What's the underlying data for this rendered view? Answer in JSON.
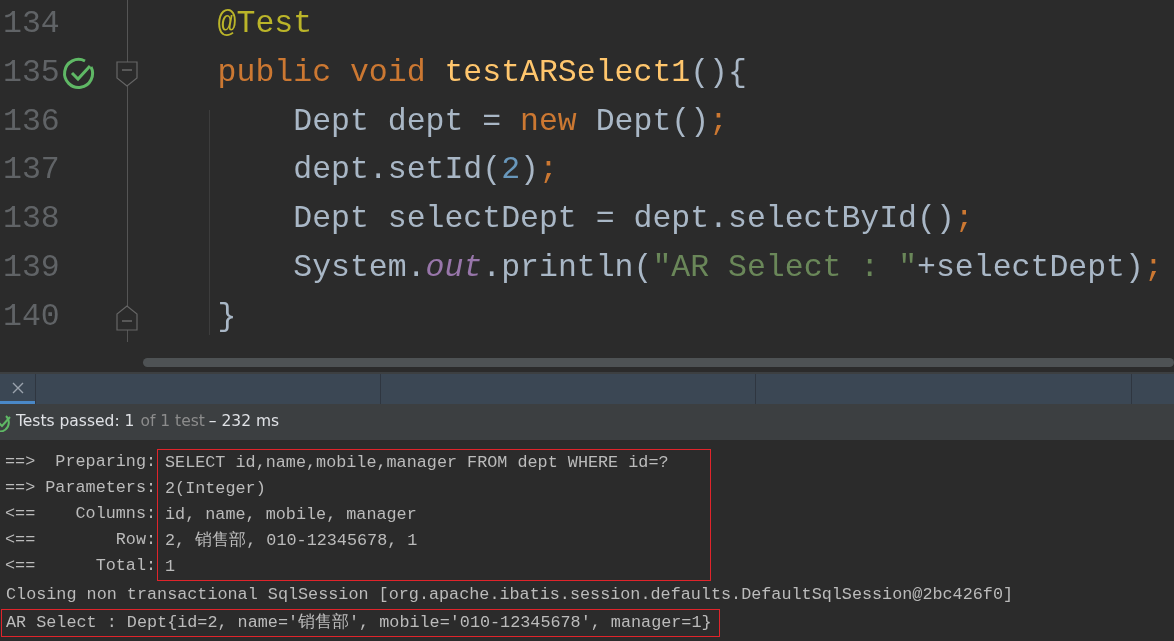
{
  "editor": {
    "lines": [
      {
        "number": "134",
        "tokens": [
          {
            "kind": "annotation",
            "text": "    @Test"
          }
        ]
      },
      {
        "number": "135",
        "test_passed": true,
        "fold_start": true,
        "tokens": [
          {
            "kind": "keyword",
            "text": "    public void "
          },
          {
            "kind": "method",
            "text": "testARSelect1"
          },
          {
            "kind": "plain",
            "text": "(){"
          }
        ]
      },
      {
        "number": "136",
        "tokens": [
          {
            "kind": "plain",
            "text": "        Dept dept = "
          },
          {
            "kind": "keyword",
            "text": "new "
          },
          {
            "kind": "plain",
            "text": "Dept()"
          },
          {
            "kind": "keyword",
            "text": ";"
          }
        ]
      },
      {
        "number": "137",
        "tokens": [
          {
            "kind": "plain",
            "text": "        dept.setId("
          },
          {
            "kind": "number",
            "text": "2"
          },
          {
            "kind": "plain",
            "text": ")"
          },
          {
            "kind": "keyword",
            "text": ";"
          }
        ]
      },
      {
        "number": "138",
        "tokens": [
          {
            "kind": "plain",
            "text": "        Dept selectDept = dept.selectById()"
          },
          {
            "kind": "keyword",
            "text": ";"
          }
        ]
      },
      {
        "number": "139",
        "tokens": [
          {
            "kind": "plain",
            "text": "        System."
          },
          {
            "kind": "static",
            "text": "out"
          },
          {
            "kind": "plain",
            "text": ".println("
          },
          {
            "kind": "string",
            "text": "\"AR Select : \""
          },
          {
            "kind": "plain",
            "text": "+selectDept)"
          },
          {
            "kind": "keyword",
            "text": ";"
          }
        ]
      },
      {
        "number": "140",
        "fold_end": true,
        "tokens": [
          {
            "kind": "plain",
            "text": "    }"
          }
        ]
      }
    ]
  },
  "run_panel": {
    "tabs": [
      {
        "selected": true
      }
    ],
    "status": {
      "passed": true,
      "count": "Tests passed: 1",
      "total": "of 1 test",
      "duration": "– 232 ms"
    }
  },
  "console": {
    "query_log": {
      "highlighted": true,
      "rows": [
        {
          "prefix": "==>  Preparing:",
          "value": "SELECT id,name,mobile,manager FROM dept WHERE id=?"
        },
        {
          "prefix": "==> Parameters:",
          "value": "2(Integer)"
        },
        {
          "prefix": "<==    Columns:",
          "value": "id, name, mobile, manager"
        },
        {
          "prefix": "<==        Row:",
          "value": "2, 销售部, 010-12345678, 1"
        },
        {
          "prefix": "<==      Total:",
          "value": "1"
        }
      ]
    },
    "lines": [
      {
        "text": "Closing non transactional SqlSession [org.apache.ibatis.session.defaults.DefaultSqlSession@2bc426f0]",
        "highlighted": false
      },
      {
        "text": "AR Select : Dept{id=2, name='销售部', mobile='010-12345678', manager=1}",
        "highlighted": true
      }
    ]
  }
}
